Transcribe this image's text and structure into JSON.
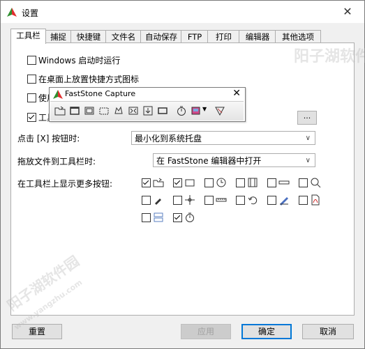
{
  "window": {
    "title": "设置"
  },
  "tabs": [
    "工具栏",
    "捕捉",
    "快捷键",
    "文件名",
    "自动保存",
    "FTP",
    "打印",
    "编辑器",
    "其他选项"
  ],
  "options": {
    "startup": "Windows 启动时运行",
    "desktop_shortcut": "在桌面上放置快捷方式图标",
    "third": "使用",
    "fourth": "工具"
  },
  "floating_toolbar": {
    "title": "FastStone Capture"
  },
  "more_button": "...",
  "close_action": {
    "label": "点击 [X] 按钮时:",
    "value": "最小化到系统托盘"
  },
  "drag_action": {
    "label": "拖放文件到工具栏时:",
    "value": "在 FastStone 编辑器中打开"
  },
  "more_buttons": {
    "label": "在工具栏上显示更多按钮:"
  },
  "buttons": {
    "reset": "重置",
    "apply": "应用",
    "ok": "确定",
    "cancel": "取消"
  },
  "watermark": {
    "text": "阳子湖软件园",
    "url": "www.yangzhu.com"
  }
}
